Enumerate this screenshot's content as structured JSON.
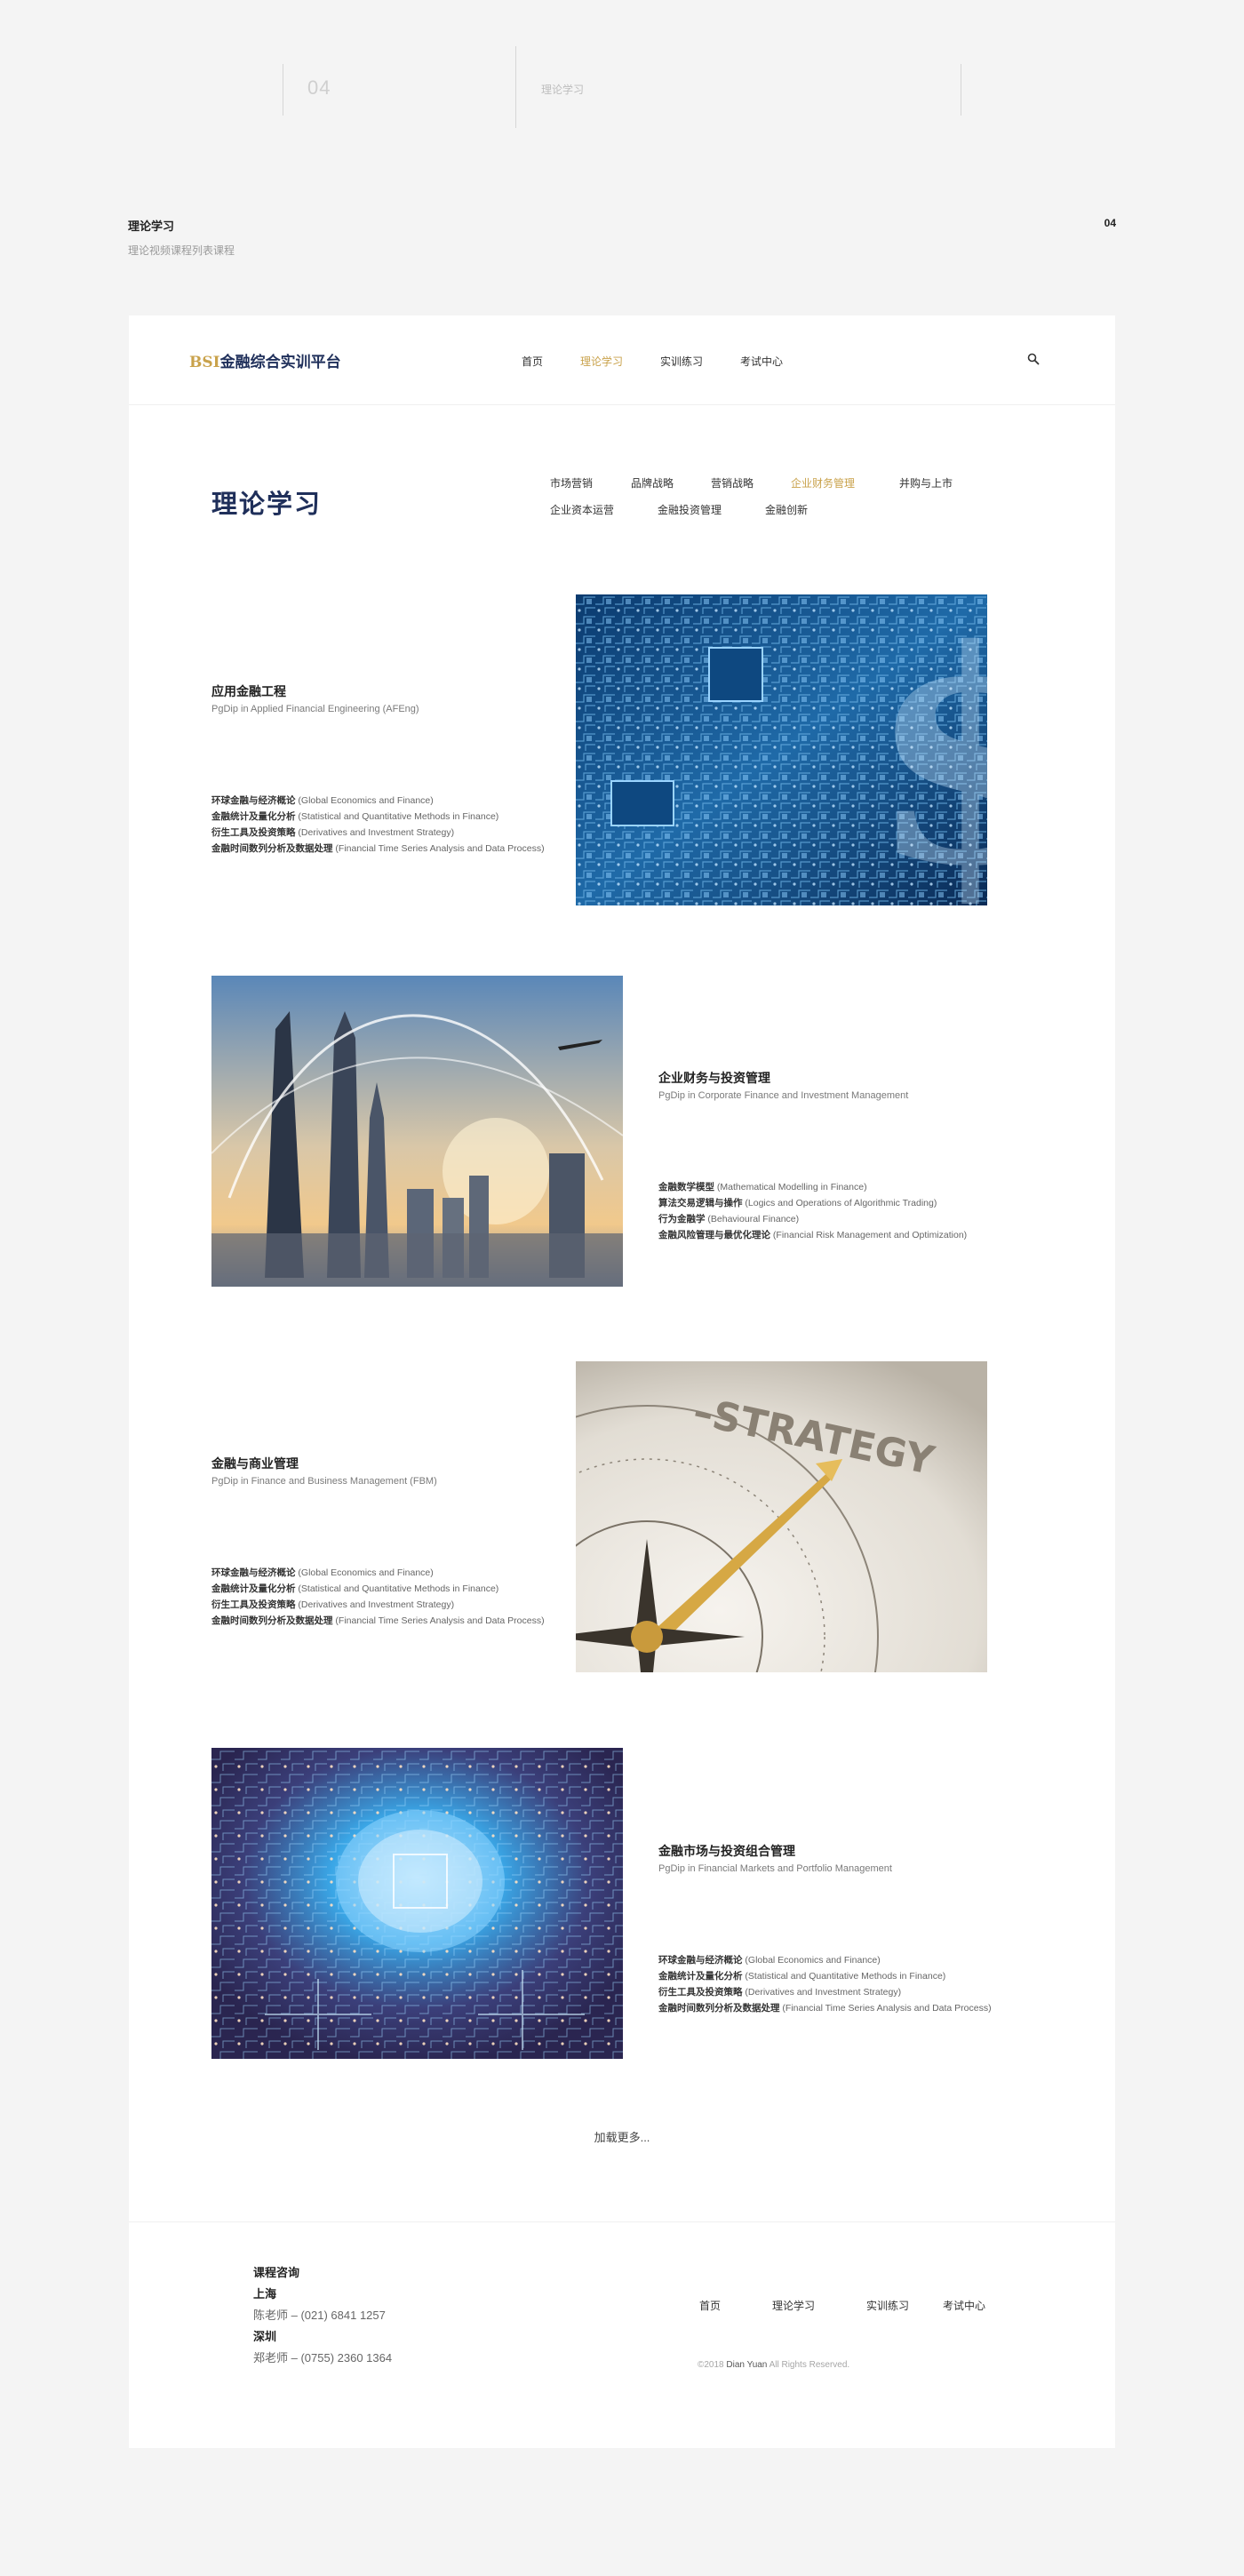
{
  "top": {
    "number": "04",
    "label": "理论学习"
  },
  "section": {
    "title": "理论学习",
    "subtitle": "理论视频课程列表课程",
    "number": "04"
  },
  "header": {
    "logo_brand": "BSI",
    "logo_text": "金融综合实训平台",
    "nav": [
      {
        "label": "首页",
        "active": false
      },
      {
        "label": "理论学习",
        "active": true
      },
      {
        "label": "实训练习",
        "active": false
      },
      {
        "label": "考试中心",
        "active": false
      }
    ],
    "search_icon": "search-icon"
  },
  "main": {
    "page_title": "理论学习",
    "categories": [
      {
        "label": "市场营销",
        "active": false
      },
      {
        "label": "品牌战略",
        "active": false
      },
      {
        "label": "营销战略",
        "active": false
      },
      {
        "label": "企业财务管理",
        "active": true
      },
      {
        "label": "并购与上市",
        "active": false
      },
      {
        "label": "企业资本运营",
        "active": false
      },
      {
        "label": "金融投资管理",
        "active": false
      },
      {
        "label": "金融创新",
        "active": false
      }
    ],
    "courses": [
      {
        "name": "应用金融工程",
        "name_en": "PgDip in Applied Financial Engineering (AFEng)",
        "image": "circuit-dollar-image",
        "modules": [
          {
            "zh": "环球金融与经济概论",
            "en": " (Global Economics and Finance)"
          },
          {
            "zh": "金融统计及量化分析",
            "en": " (Statistical and Quantitative Methods in Finance)"
          },
          {
            "zh": "衍生工具及投资策略",
            "en": " (Derivatives and Investment Strategy)"
          },
          {
            "zh": "金融时间数列分析及数据处理",
            "en": " (Financial Time Series Analysis and Data Process)"
          }
        ]
      },
      {
        "name": "企业财务与投资管理",
        "name_en": "PgDip in Corporate Finance and Investment Management",
        "image": "city-skyline-image",
        "modules": [
          {
            "zh": "金融数学模型",
            "en": "  (Mathematical Modelling in Finance)"
          },
          {
            "zh": "算法交易逻辑与操作",
            "en": "  (Logics and Operations of Algorithmic Trading)"
          },
          {
            "zh": "行为金融学",
            "en": "  (Behavioural Finance)"
          },
          {
            "zh": "金融风险管理与最优化理论",
            "en": " (Financial Risk Management and Optimization)"
          }
        ]
      },
      {
        "name": "金融与商业管理",
        "name_en": "PgDip in Finance and Business Management (FBM)",
        "image": "strategy-compass-image",
        "modules": [
          {
            "zh": "环球金融与经济概论",
            "en": " (Global Economics and Finance)"
          },
          {
            "zh": "金融统计及量化分析",
            "en": " (Statistical and Quantitative Methods in Finance)"
          },
          {
            "zh": "衍生工具及投资策略",
            "en": " (Derivatives and Investment Strategy)"
          },
          {
            "zh": "金融时间数列分析及数据处理",
            "en": " (Financial Time Series Analysis and Data Process)"
          }
        ]
      },
      {
        "name": "金融市场与投资组合管理",
        "name_en": "PgDip in Financial Markets and Portfolio Management",
        "image": "digital-brain-image",
        "modules": [
          {
            "zh": "环球金融与经济概论",
            "en": " (Global Economics and Finance)"
          },
          {
            "zh": "金融统计及量化分析",
            "en": " (Statistical and Quantitative Methods in Finance)"
          },
          {
            "zh": "衍生工具及投资策略",
            "en": " (Derivatives and Investment Strategy)"
          },
          {
            "zh": "金融时间数列分析及数据处理",
            "en": " (Financial Time Series Analysis and Data Process)"
          }
        ]
      }
    ],
    "load_more": "加载更多..."
  },
  "footer": {
    "contact_title": "课程咨询",
    "city1": "上海",
    "contact1": "陈老师 – (021) 6841 1257",
    "city2": "深圳",
    "contact2": "郑老师 – (0755) 2360 1364",
    "nav": [
      "首页",
      "理论学习",
      "实训练习",
      "考试中心"
    ],
    "copyright_prefix": "©2018 ",
    "copyright_brand": "Dian Yuan",
    "copyright_suffix": " All Rights Reserved."
  },
  "colors": {
    "accent": "#c9a24b",
    "navy": "#1f2f5a",
    "background": "#f4f4f4"
  }
}
